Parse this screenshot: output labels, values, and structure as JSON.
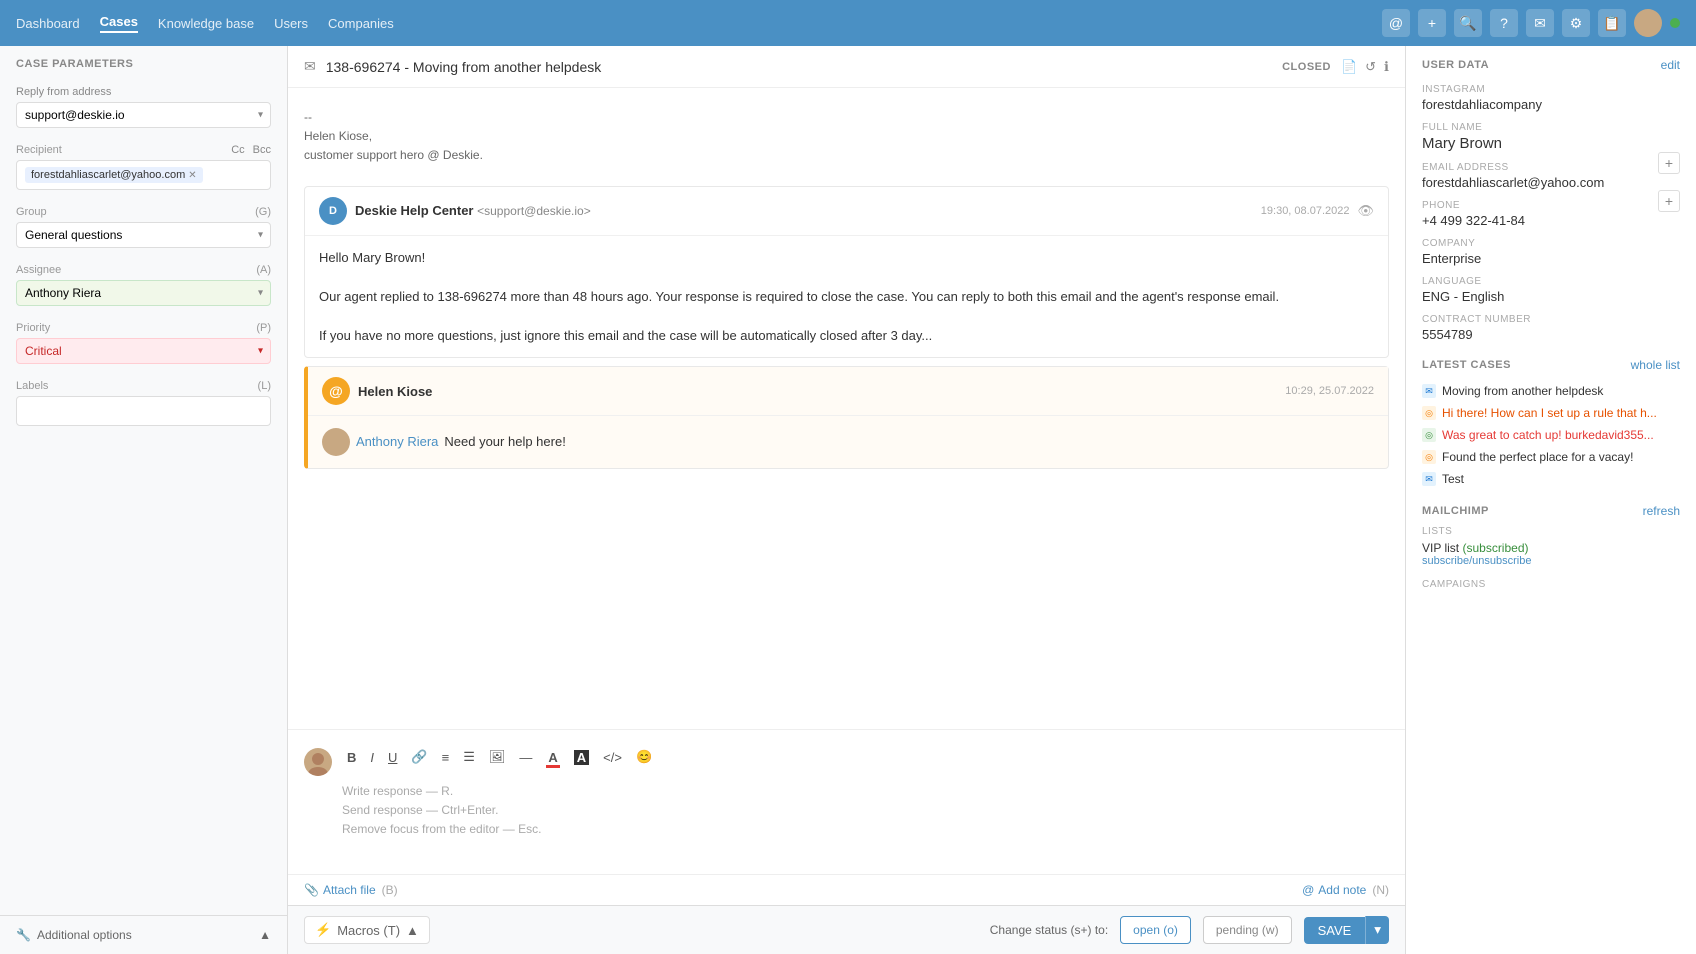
{
  "nav": {
    "links": [
      "Dashboard",
      "Cases",
      "Knowledge base",
      "Users",
      "Companies"
    ],
    "active": "Cases",
    "icons": [
      "@",
      "+",
      "🔍",
      "?",
      "✉",
      "⚙",
      "📋",
      "👤",
      "●"
    ]
  },
  "left_panel": {
    "header": "CASE PARAMETERS",
    "reply_from_label": "Reply from address",
    "reply_from_value": "support@deskie.io",
    "recipient_label": "Recipient",
    "cc_label": "Cc",
    "bcc_label": "Bcc",
    "recipient_value": "forestdahliascarlet@yahoo.com",
    "group_label": "Group",
    "group_shortcut": "(G)",
    "group_value": "General questions",
    "assignee_label": "Assignee",
    "assignee_shortcut": "(A)",
    "assignee_value": "Anthony Riera",
    "priority_label": "Priority",
    "priority_shortcut": "(P)",
    "priority_value": "Critical",
    "labels_label": "Labels",
    "labels_shortcut": "(L)",
    "additional_options": "Additional options"
  },
  "case_header": {
    "case_number": "138-696274 - Moving from another helpdesk",
    "status": "CLOSED"
  },
  "messages": [
    {
      "type": "signature",
      "lines": [
        "--",
        "Helen Kiose,",
        "customer support hero @ Deskie."
      ]
    },
    {
      "type": "email",
      "sender": "Deskie Help Center",
      "sender_email": "<support@deskie.io>",
      "time": "19:30, 08.07.2022",
      "body": "Hello Mary Brown!\n\nOur agent replied to 138-696274 more than 48 hours ago. Your response is required to close the case. You can reply to both this email and the agent's response email.\n\nIf you have no more questions, just ignore this email and the case will be automatically closed after 3 day..."
    },
    {
      "type": "mention",
      "sender": "Helen Kiose",
      "time": "10:29, 25.07.2022",
      "mention": "Anthony Riera",
      "body": "Need your help here!"
    }
  ],
  "editor": {
    "placeholder_line1": "Write response — R.",
    "placeholder_line2": "Send response — Ctrl+Enter.",
    "placeholder_line3": "Remove focus from the editor — Esc.",
    "attach_label": "Attach file",
    "attach_shortcut": "(B)",
    "note_label": "Add note",
    "note_shortcut": "(N)"
  },
  "bottom_bar": {
    "macros_label": "Macros (T)",
    "status_label": "Change status (s+) to:",
    "open_label": "open (o)",
    "pending_label": "pending (w)",
    "save_label": "SAVE"
  },
  "right_panel": {
    "section_title": "USER DATA",
    "edit_label": "edit",
    "instagram_label": "INSTAGRAM",
    "instagram_value": "forestdahliacompany",
    "full_name_label": "FULL NAME",
    "full_name_value": "Mary Brown",
    "email_label": "EMAIL ADDRESS",
    "email_value": "forestdahliascarlet@yahoo.com",
    "phone_label": "PHONE",
    "phone_value": "+4 499 322-41-84",
    "company_label": "COMPANY",
    "company_value": "Enterprise",
    "language_label": "LANGUAGE",
    "language_value": "ENG - English",
    "contract_label": "CONTRACT NUMBER",
    "contract_value": "5554789",
    "latest_cases_title": "LATEST CASES",
    "whole_list": "whole list",
    "cases": [
      {
        "type": "email",
        "text": "Moving from another helpdesk",
        "active": true
      },
      {
        "type": "orange",
        "text": "Hi there! How can I set up a rule that h...",
        "color": "orange"
      },
      {
        "type": "green",
        "text": "Was great to catch up! burkedavid355...",
        "color": "red"
      },
      {
        "type": "orange",
        "text": "Found the perfect place for a vacay!",
        "color": "normal"
      },
      {
        "type": "email",
        "text": "Test",
        "color": "normal"
      }
    ],
    "mailchimp_label": "Mailchimp",
    "refresh_label": "refresh",
    "lists_label": "LISTS",
    "vip_list": "VIP list",
    "subscribed": "(subscribed)",
    "subscribe_link": "subscribe/unsubscribe",
    "campaigns_label": "CAMPAIGNS"
  }
}
